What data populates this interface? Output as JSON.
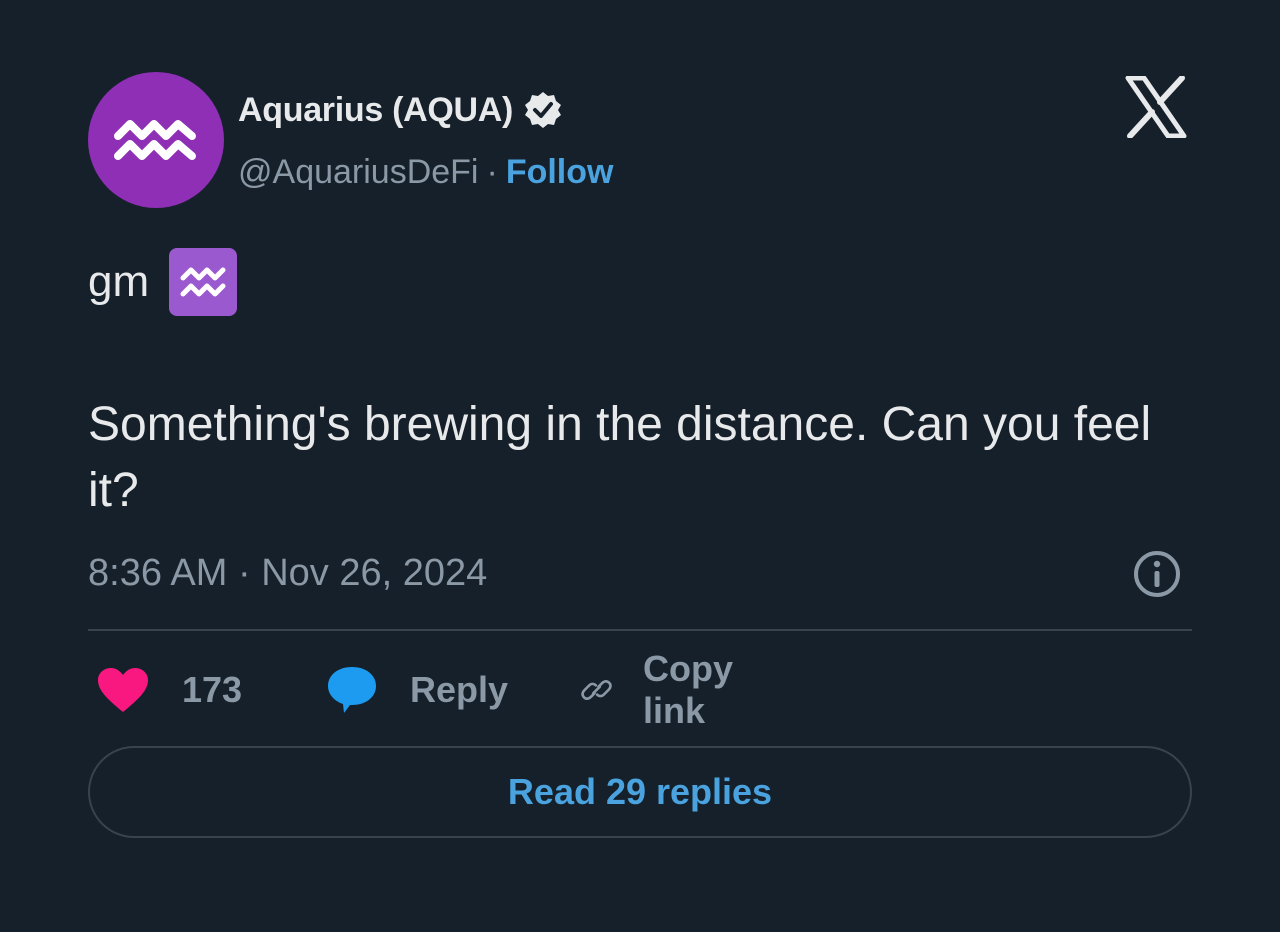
{
  "author": {
    "display_name": "Aquarius (AQUA)",
    "handle": "@AquariusDeFi",
    "separator": "·",
    "follow_label": "Follow",
    "avatar_color": "#8e2fb5",
    "avatar_icon": "aquarius-zodiac-icon",
    "verified_icon": "verified-badge-icon"
  },
  "platform_icon": "x-logo-icon",
  "tweet": {
    "line1_text": "gm",
    "line1_emoji": "aquarius-emoji",
    "body": "Something's brewing in the distance. Can you feel it?",
    "timestamp": "8:36 AM · Nov 26, 2024"
  },
  "actions": {
    "like_count": "173",
    "like_color": "#f91880",
    "reply_label": "Reply",
    "reply_color": "#1d9bf0",
    "copy_label": "Copy link"
  },
  "read_replies_label": "Read 29 replies",
  "colors": {
    "background": "#15202b",
    "link": "#4aa3df",
    "muted": "#8b98a5",
    "text": "#e7e9ea"
  }
}
